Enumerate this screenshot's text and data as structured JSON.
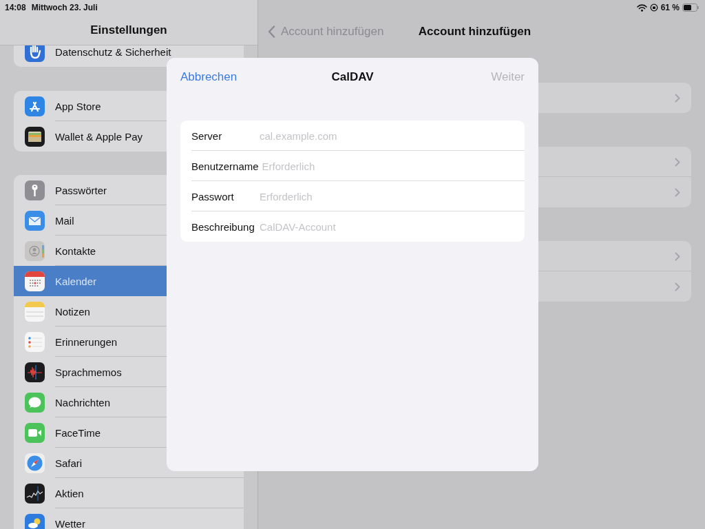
{
  "status_bar": {
    "time": "14:08",
    "date": "Mittwoch 23. Juli",
    "battery_percent": "61 %"
  },
  "sidebar": {
    "title": "Einstellungen",
    "groups": [
      {
        "items": [
          {
            "kind": "privacy",
            "label": "Datenschutz & Sicherheit",
            "selected": false
          }
        ]
      },
      {
        "items": [
          {
            "kind": "appstore",
            "label": "App Store",
            "selected": false
          },
          {
            "kind": "wallet",
            "label": "Wallet & Apple Pay",
            "selected": false
          }
        ]
      },
      {
        "items": [
          {
            "kind": "passwords",
            "label": "Passwörter",
            "selected": false
          },
          {
            "kind": "mail",
            "label": "Mail",
            "selected": false
          },
          {
            "kind": "contacts",
            "label": "Kontakte",
            "selected": false
          },
          {
            "kind": "calendar",
            "label": "Kalender",
            "selected": true
          },
          {
            "kind": "notes",
            "label": "Notizen",
            "selected": false
          },
          {
            "kind": "reminders",
            "label": "Erinnerungen",
            "selected": false
          },
          {
            "kind": "voicememos",
            "label": "Sprachmemos",
            "selected": false
          },
          {
            "kind": "messages",
            "label": "Nachrichten",
            "selected": false
          },
          {
            "kind": "facetime",
            "label": "FaceTime",
            "selected": false
          },
          {
            "kind": "safari",
            "label": "Safari",
            "selected": false
          },
          {
            "kind": "stocks",
            "label": "Aktien",
            "selected": false
          },
          {
            "kind": "weather",
            "label": "Wetter",
            "selected": false
          }
        ]
      }
    ]
  },
  "detail": {
    "back_label": "Account hinzufügen",
    "title": "Account hinzufügen",
    "groups": [
      {
        "rows": [
          {
            "kind": "disclosure"
          }
        ]
      },
      {
        "rows": [
          {
            "kind": "disclosure"
          },
          {
            "kind": "disclosure"
          }
        ]
      },
      {
        "rows": [
          {
            "kind": "disclosure"
          },
          {
            "kind": "disclosure"
          }
        ]
      }
    ]
  },
  "dialog": {
    "cancel": "Abbrechen",
    "title": "CalDAV",
    "next": "Weiter",
    "next_disabled": true,
    "fields": [
      {
        "label": "Server",
        "placeholder": "cal.example.com"
      },
      {
        "label": "Benutzername",
        "placeholder": "Erforderlich"
      },
      {
        "label": "Passwort",
        "placeholder": "Erforderlich"
      },
      {
        "label": "Beschreibung",
        "placeholder": "CalDAV-Account"
      }
    ]
  }
}
